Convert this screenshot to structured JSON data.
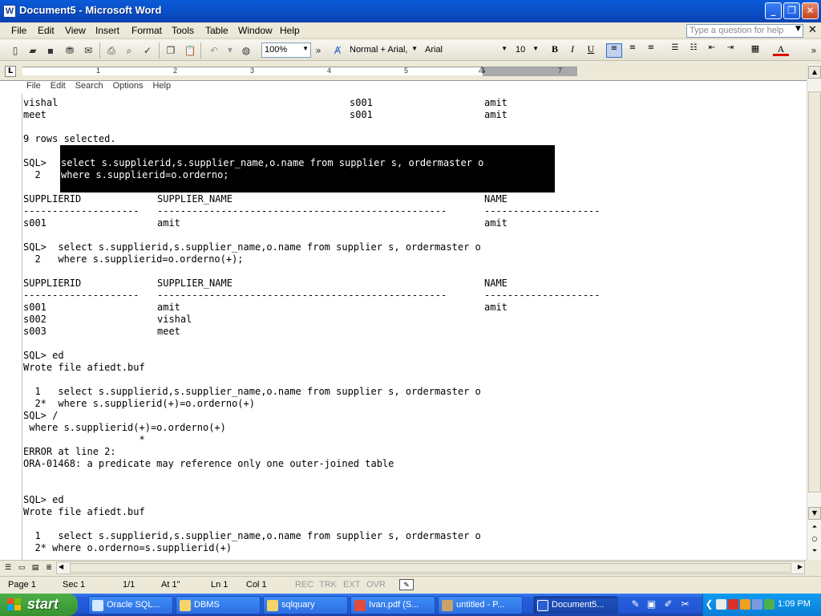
{
  "window": {
    "title": "Document5 - Microsoft Word",
    "controls": {
      "minimize": "_",
      "maximize": "❐",
      "close": "✕"
    }
  },
  "menu": {
    "items": [
      "File",
      "Edit",
      "View",
      "Insert",
      "Format",
      "Tools",
      "Table",
      "Window",
      "Help"
    ],
    "ask_placeholder": "Type a question for help",
    "close_glyph": "✕"
  },
  "toolbar": {
    "zoom": "100%",
    "style": "Normal + Arial,",
    "font": "Arial",
    "size": "10",
    "bold": "B",
    "italic": "I",
    "underline": "U",
    "font_color_glyph": "A",
    "more_glyph": "»"
  },
  "ruler": {
    "tab_selector": "L",
    "numbers": [
      "1",
      "2",
      "3",
      "4",
      "5",
      "6",
      "7"
    ]
  },
  "doc_menu": [
    "File",
    "Edit",
    "Search",
    "Options",
    "Help"
  ],
  "doc": {
    "top_rows": [
      {
        "c1": "vishal",
        "c2": "s001",
        "c3": "amit"
      },
      {
        "c1": "meet",
        "c2": "s001",
        "c3": "amit"
      }
    ],
    "rows_selected": "9 rows selected.",
    "q1_prompt": "SQL>",
    "q1_line1": "select s.supplierid,s.supplier_name,o.name from supplier s, ordermaster o",
    "q1_ln2": "  2",
    "q1_line2": "where s.supplierid=o.orderno;",
    "h1": {
      "c1": "SUPPLIERID",
      "c2": "SUPPLIER_NAME",
      "c3": "NAME"
    },
    "dash1": {
      "c1": "--------------------",
      "c2": "--------------------------------------------------",
      "c3": "--------------------"
    },
    "r1": {
      "c1": "s001",
      "c2": "amit",
      "c3": "amit"
    },
    "q2_line1": "SQL>  select s.supplierid,s.supplier_name,o.name from supplier s, ordermaster o",
    "q2_line2": "  2   where s.supplierid=o.orderno(+);",
    "h2": {
      "c1": "SUPPLIERID",
      "c2": "SUPPLIER_NAME",
      "c3": "NAME"
    },
    "dash2": {
      "c1": "--------------------",
      "c2": "--------------------------------------------------",
      "c3": "--------------------"
    },
    "r2": [
      {
        "c1": "s001",
        "c2": "amit",
        "c3": "amit"
      },
      {
        "c1": "s002",
        "c2": "vishal",
        "c3": ""
      },
      {
        "c1": "s003",
        "c2": "meet",
        "c3": ""
      }
    ],
    "ed1": "SQL> ed",
    "wrote1": "Wrote file afiedt.buf",
    "e1_l1": "  1   select s.supplierid,s.supplier_name,o.name from supplier s, ordermaster o",
    "e1_l2": "  2*  where s.supplierid(+)=o.orderno(+)",
    "slash": "SQL> /",
    "err_echo": " where s.supplierid(+)=o.orderno(+)",
    "err_star": "                    *",
    "err_line": "ERROR at line 2:",
    "ora": "ORA-01468: a predicate may reference only one outer-joined table",
    "ed2": "SQL> ed",
    "wrote2": "Wrote file afiedt.buf",
    "e2_l1": "  1   select s.supplierid,s.supplier_name,o.name from supplier s, ordermaster o",
    "e2_l2": "  2* where o.orderno=s.supplierid(+)"
  },
  "status": {
    "page": "Page 1",
    "sec": "Sec 1",
    "pages": "1/1",
    "at": "At 1\"",
    "ln": "Ln 1",
    "col": "Col 1",
    "rec": "REC",
    "trk": "TRK",
    "ext": "EXT",
    "ovr": "OVR"
  },
  "taskbar": {
    "start": "start",
    "tasks": [
      "Oracle SQL...",
      "DBMS",
      "sqlquary",
      "Ivan.pdf (S...",
      "untitled - P...",
      "Document5..."
    ],
    "clock": "1:09 PM"
  },
  "colors": {
    "titlebar": "#0a4fc6",
    "taskbar": "#245edb",
    "start": "#37932f",
    "tray": "#0b7ed6"
  }
}
